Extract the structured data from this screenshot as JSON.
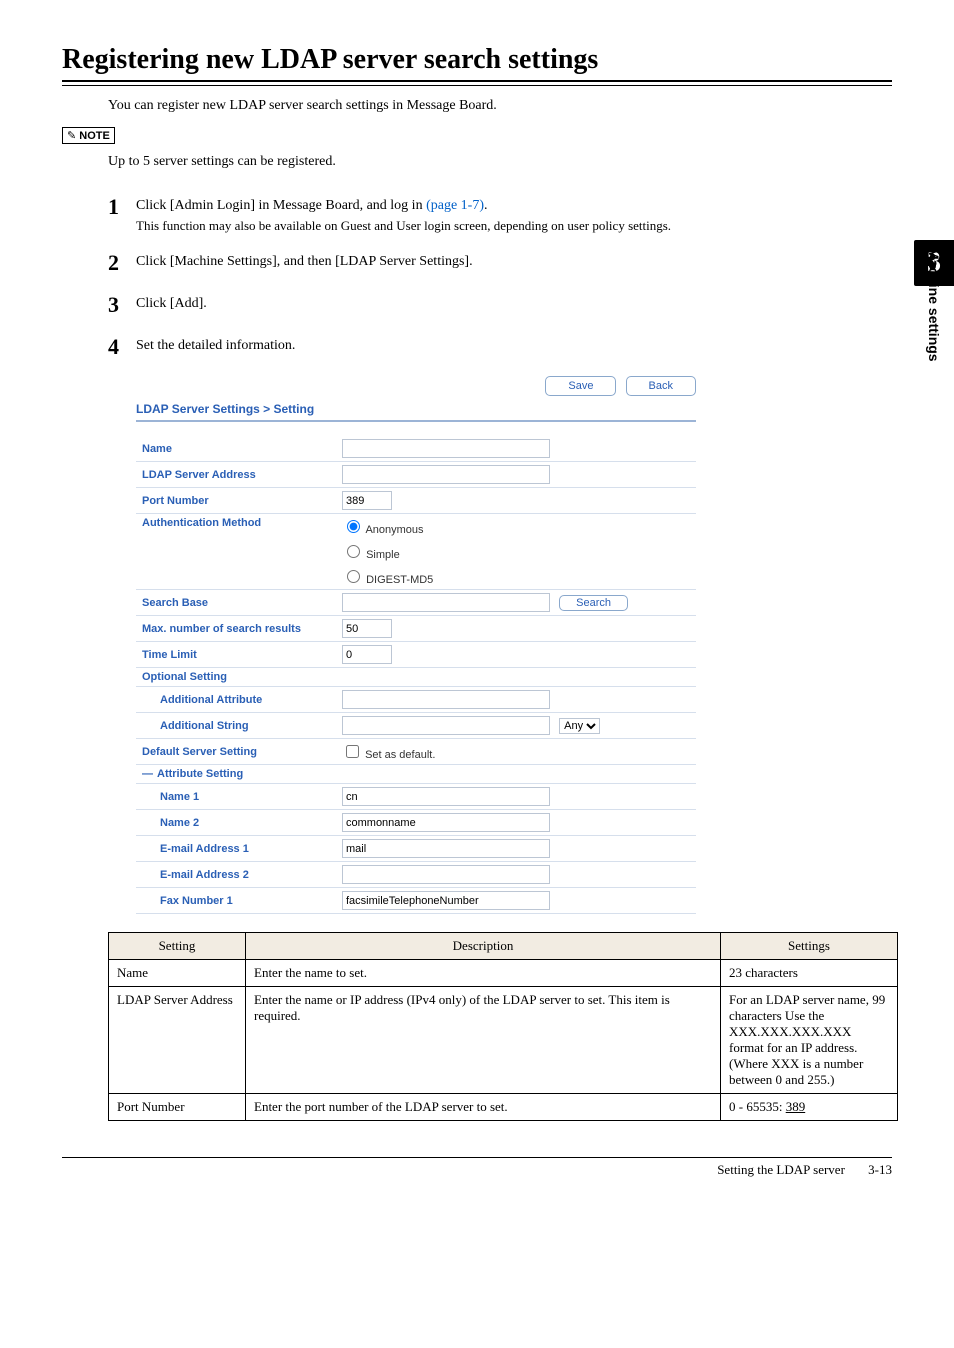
{
  "sidebar": {
    "chapter_number": "3",
    "label": "Machine settings"
  },
  "title": "Registering new LDAP server search settings",
  "intro": "You can register new LDAP server search settings in Message Board.",
  "note_label": "NOTE",
  "note_text": "Up to 5 server settings can be registered.",
  "steps": {
    "s1": {
      "num": "1",
      "text_a": "Click [Admin Login] in Message Board, and log in ",
      "link": "(page 1-7)",
      "text_b": ".",
      "sub": "This function may also be available on Guest and User login screen, depending on user policy settings."
    },
    "s2": {
      "num": "2",
      "text": "Click [Machine Settings], and then [LDAP Server Settings]."
    },
    "s3": {
      "num": "3",
      "text": "Click [Add]."
    },
    "s4": {
      "num": "4",
      "text": "Set the detailed information."
    }
  },
  "ui": {
    "save": "Save",
    "back": "Back",
    "heading": "LDAP Server Settings > Setting",
    "rows": {
      "name": "Name",
      "server_addr": "LDAP Server Address",
      "port": "Port Number",
      "port_val": "389",
      "auth_method": "Authentication Method",
      "auth_anon": "Anonymous",
      "auth_simple": "Simple",
      "auth_digest": "DIGEST-MD5",
      "search_base": "Search Base",
      "search_btn": "Search",
      "max_results": "Max. number of search results",
      "max_results_val": "50",
      "time_limit": "Time Limit",
      "time_limit_val": "0",
      "optional": "Optional Setting",
      "add_attr": "Additional Attribute",
      "add_string": "Additional String",
      "any": "Any",
      "default_server": "Default Server Setting",
      "set_default": "Set as default.",
      "attr_setting": "Attribute Setting",
      "name1": "Name 1",
      "name1_val": "cn",
      "name2": "Name 2",
      "name2_val": "commonname",
      "email1": "E-mail Address 1",
      "email1_val": "mail",
      "email2": "E-mail Address 2",
      "fax1": "Fax Number 1",
      "fax1_val": "facsimileTelephoneNumber"
    }
  },
  "table": {
    "headers": {
      "setting": "Setting",
      "desc": "Description",
      "settings": "Settings"
    },
    "row1": {
      "setting": "Name",
      "desc": "Enter the name to set.",
      "settings": "23 characters"
    },
    "row2": {
      "setting": "LDAP Server Address",
      "desc": "Enter the name or IP address (IPv4 only) of the LDAP server to set. This item is required.",
      "settings": "For an LDAP server name, 99 characters Use the XXX.XXX.XXX.XXX format for an IP address. (Where XXX is a number between 0 and 255.)"
    },
    "row3": {
      "setting": "Port Number",
      "desc": "Enter the port number of the LDAP server to set.",
      "settings_a": "0 - 65535: ",
      "settings_b": "389"
    }
  },
  "footer": {
    "title": "Setting the LDAP server",
    "page": "3-13"
  }
}
